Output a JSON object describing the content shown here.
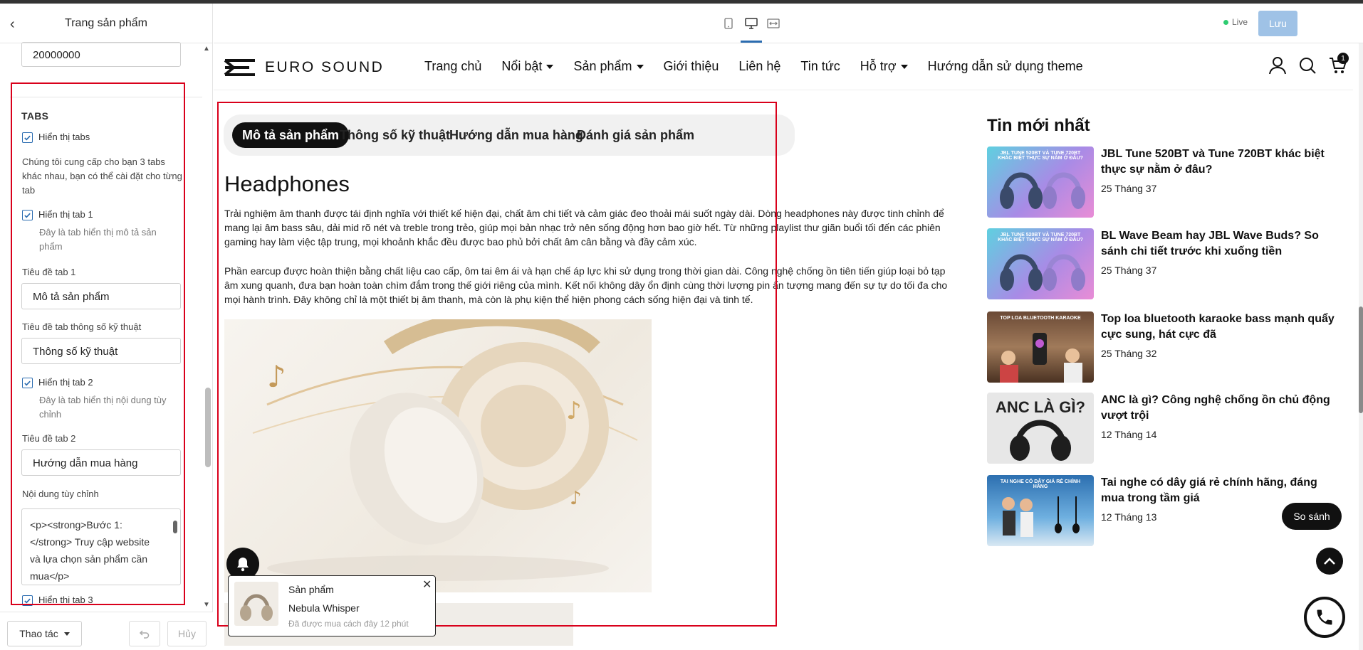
{
  "panel": {
    "title": "Trang sản phẩm",
    "price_value": "20000000",
    "tabs_heading": "TABS",
    "show_tabs_label": "Hiển thị tabs",
    "tabs_description": "Chúng tôi cung cấp cho bạn 3 tabs khác nhau, bạn có thể cài đặt cho từng tab",
    "show_tab1_label": "Hiển thị tab 1",
    "tab1_hint": "Đây là tab hiển thị mô tả sản phẩm",
    "tab1_title_label": "Tiêu đề tab 1",
    "tab1_title_value": "Mô tả sản phẩm",
    "spec_title_label": "Tiêu đề tab thông số kỹ thuật",
    "spec_title_value": "Thông số kỹ thuật",
    "show_tab2_label": "Hiển thị tab 2",
    "tab2_hint": "Đây là tab hiển thị nội dung tùy chỉnh",
    "tab2_title_label": "Tiêu đề tab 2",
    "tab2_title_value": "Hướng dẫn mua hàng",
    "custom_content_label": "Nội dung tùy chỉnh",
    "custom_content_value": "<p><strong>Bước 1:</strong> Truy cập website và lựa chọn sản phẩm cần mua</p>",
    "show_tab3_label": "Hiển thị tab 3",
    "footer": {
      "actions_label": "Thao tác",
      "cancel_label": "Hủy"
    }
  },
  "toolbar": {
    "live_label": "Live",
    "save_label": "Lưu"
  },
  "site": {
    "logo_text": "EURO SOUND",
    "menu": [
      {
        "label": "Trang chủ",
        "dropdown": false
      },
      {
        "label": "Nổi bật",
        "dropdown": true
      },
      {
        "label": "Sản phẩm",
        "dropdown": true
      },
      {
        "label": "Giới thiệu",
        "dropdown": false
      },
      {
        "label": "Liên hệ",
        "dropdown": false
      },
      {
        "label": "Tin tức",
        "dropdown": false
      },
      {
        "label": "Hỗ trợ",
        "dropdown": true
      },
      {
        "label": "Hướng dẫn sử dụng theme",
        "dropdown": false
      }
    ],
    "cart_count": "1"
  },
  "product": {
    "tabs": [
      "Mô tả sản phẩm",
      "Thông số kỹ thuật",
      "Hướng dẫn mua hàng",
      "Đánh giá sản phẩm"
    ],
    "active_tab": 0,
    "heading": "Headphones",
    "para1": "Trải nghiệm âm thanh được tái định nghĩa với thiết kế hiện đại, chất âm chi tiết và cảm giác đeo thoải mái suốt ngày dài. Dòng headphones này được tinh chỉnh để mang lại âm bass sâu, dải mid rõ nét và treble trong trẻo, giúp mọi bản nhạc trở nên sống động hơn bao giờ hết. Từ những playlist thư giãn buổi tối đến các phiên gaming hay làm việc tập trung, mọi khoảnh khắc đều được bao phủ bởi chất âm cân bằng và đầy cảm xúc.",
    "para2": "Phần earcup được hoàn thiện bằng chất liệu cao cấp, ôm tai êm ái và hạn chế áp lực khi sử dụng trong thời gian dài. Công nghệ chống ồn tiên tiến giúp loại bỏ tạp âm xung quanh, đưa bạn hoàn toàn chìm đắm trong thế giới riêng của mình. Kết nối không dây ổn định cùng thời lượng pin ấn tượng mang đến sự tự do tối đa cho mọi hành trình. Đây không chỉ là một thiết bị âm thanh, mà còn là phụ kiện thể hiện phong cách sống hiện đại và tinh tế."
  },
  "news": {
    "title": "Tin mới nhất",
    "items": [
      {
        "headline": "JBL Tune 520BT và Tune 720BT khác biệt thực sự nằm ở đâu?",
        "date": "25 Tháng 37"
      },
      {
        "headline": "BL Wave Beam hay JBL Wave Buds? So sánh chi tiết trước khi xuống tiền",
        "date": "25 Tháng 37"
      },
      {
        "headline": "Top loa bluetooth karaoke bass mạnh quẩy cực sung, hát cực đã",
        "date": "25 Tháng 32"
      },
      {
        "headline": "ANC là gì? Công nghệ chống ồn chủ động vượt trội",
        "date": "12 Tháng 14"
      },
      {
        "headline": "Tai nghe có dây giá rẻ chính hãng, đáng mua trong tầm giá",
        "date": "12 Tháng 13"
      }
    ],
    "thumb_texts": [
      "JBL TUNE 520BT VÀ TUNE 720BT KHÁC BIỆT THỰC SỰ NẰM Ở ĐÂU?",
      "JBL TUNE 520BT VÀ TUNE 720BT KHÁC BIỆT THỰC SỰ NẰM Ở ĐÂU?",
      "TOP LOA BLUETOOTH KARAOKE",
      "ANC LÀ GÌ?",
      "TAI NGHE CÓ DÂY GIÁ RẺ CHÍNH HÃNG"
    ]
  },
  "floating": {
    "compare_label": "So sánh",
    "popup_line1": "Sản phẩm",
    "popup_line2": "Nebula Whisper",
    "popup_line3": "Đã được mua cách đây 12 phút"
  }
}
